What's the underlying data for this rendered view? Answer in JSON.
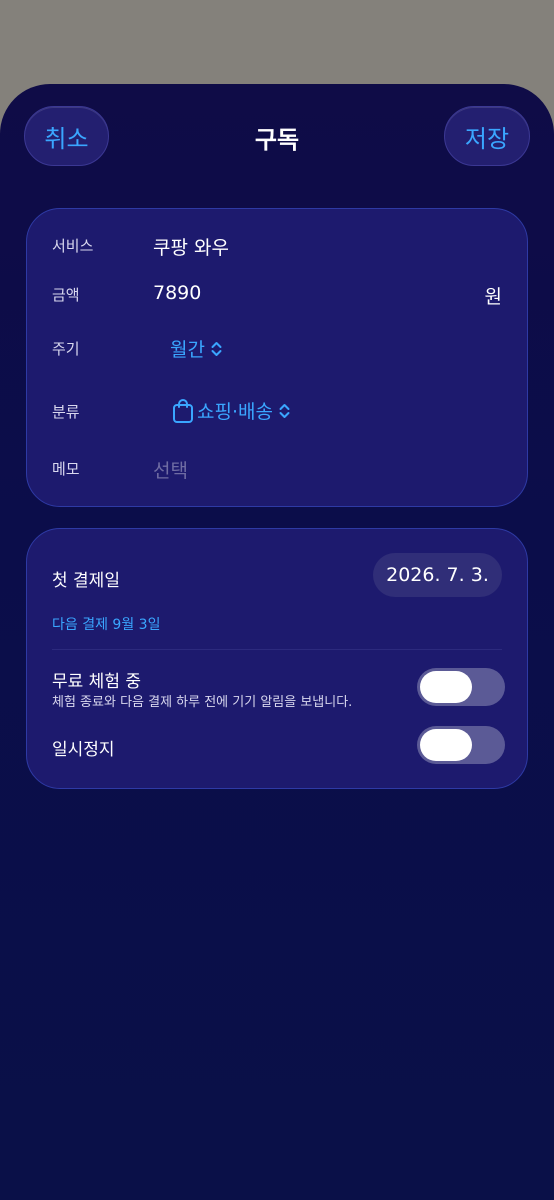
{
  "nav": {
    "cancel_label": "취소",
    "title": "구독",
    "save_label": "저장"
  },
  "details": {
    "service_label": "서비스",
    "service_value": "쿠팡 와우",
    "amount_label": "금액",
    "amount_value": "7890",
    "amount_unit": "원",
    "cycle_label": "주기",
    "cycle_value": "월간",
    "category_label": "분류",
    "category_value": "쇼핑·배송",
    "category_icon": "shopping-bag-icon",
    "memo_label": "메모",
    "memo_placeholder": "선택"
  },
  "billing": {
    "first_payment_label": "첫 결제일",
    "first_payment_date": "2026. 7. 3.",
    "next_payment_text": "다음 결제 9월 3일",
    "free_trial_label": "무료 체험 중",
    "free_trial_desc": "체험 종료와 다음 결제 하루 전에 기기 알림을 보냅니다.",
    "free_trial_on": false,
    "pause_label": "일시정지",
    "pause_on": false
  },
  "colors": {
    "accent": "#3aa6ff",
    "card_bg": "#1d1a6e",
    "sheet_bg": "#0f0c47"
  }
}
